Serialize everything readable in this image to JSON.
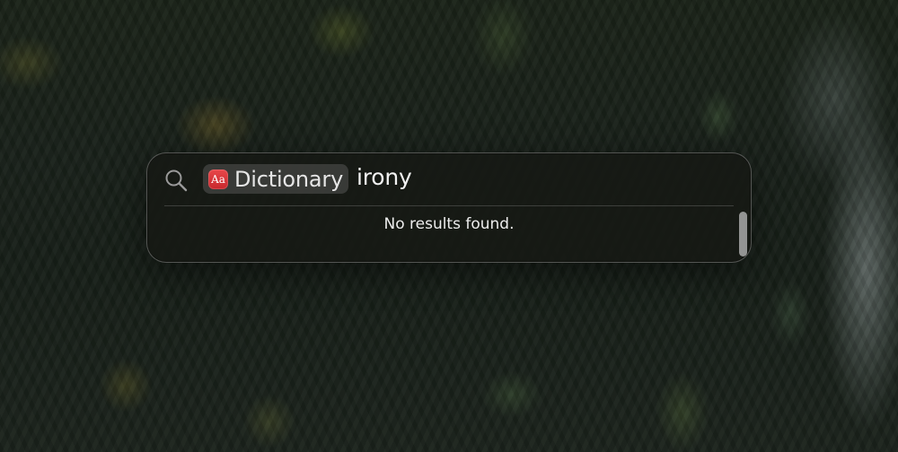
{
  "spotlight": {
    "search_icon": "magnifying-glass-icon",
    "scope": {
      "icon": "dictionary-app-icon",
      "icon_text": "Aa",
      "label": "Dictionary"
    },
    "query": "irony",
    "results": {
      "message": "No results found."
    }
  },
  "colors": {
    "dictionary_icon": "#d8353a",
    "panel_background": "#161814"
  }
}
